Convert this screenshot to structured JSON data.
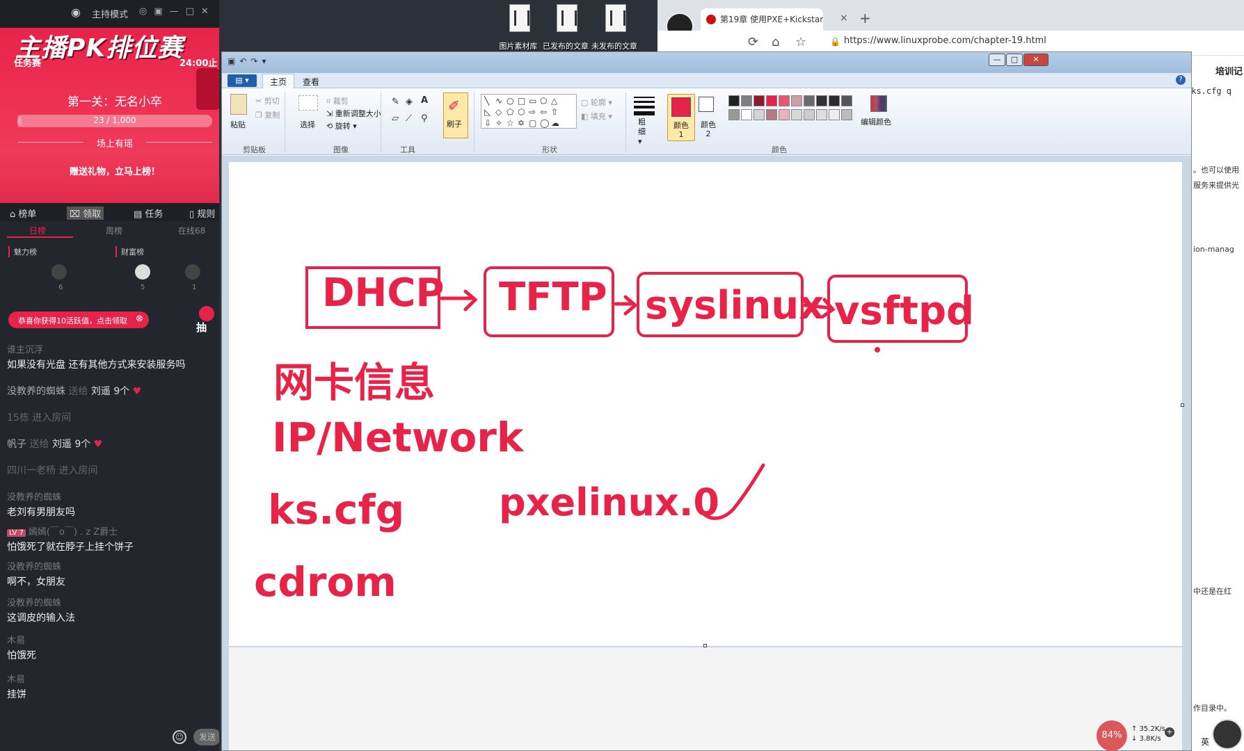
{
  "stream_panel": {
    "mode_label": "主持模式",
    "banner_title": "主播PK排位赛",
    "mission_label": "任务赛",
    "deadline": "24:00止",
    "level": "第一关：无名小卒",
    "progress_text": "23 / 1,000",
    "progress_fraction": 0.023,
    "field_top": "场上有瑶",
    "gift_tip": "赠送礼物，立马上榜！",
    "nav": [
      "榜单",
      "领取",
      "任务",
      "规则"
    ],
    "tabs": [
      "日榜",
      "周榜",
      "在线68"
    ],
    "rank_boards": [
      "魅力榜",
      "财富榜"
    ],
    "rank_nums": [
      "6",
      "5",
      "1"
    ],
    "toast": "恭喜你获得10活跃值，点击领取",
    "lottery_label": "抽",
    "send_label": "发送",
    "chat": [
      {
        "user": "谁主沉浮",
        "text": "如果没有光盘   还有其他方式来安装服务吗"
      },
      {
        "name": "没教养的蜘蛛",
        "action": "送给",
        "gift": "刘遥 9个"
      },
      {
        "name": "15栋",
        "action": "进入房间"
      },
      {
        "name": "帆子",
        "action": "送给",
        "gift": "刘遥 9个"
      },
      {
        "name": "四川一老杨",
        "action": "进入房间"
      },
      {
        "user": "没教养的蜘蛛",
        "text": "老刘有男朋友吗"
      },
      {
        "level": "LV 7",
        "user": "嫣嫣(￣o￣) . z Z爵士",
        "text": "怕饿死了就在脖子上挂个饼子"
      },
      {
        "user": "没教养的蜘蛛",
        "text": "啊不，女朋友"
      },
      {
        "user": "没教养的蜘蛛",
        "text": "这调皮的输入法"
      },
      {
        "user": "木易",
        "text": "怕饿死"
      },
      {
        "user": "木易",
        "text": "挂饼"
      }
    ]
  },
  "desktop_icons": [
    "图片素材库",
    "已发布的文章",
    "未发布的文章"
  ],
  "browser": {
    "tab_title": "第19章 使用PXE+Kickstart无人",
    "tab_close": "×",
    "new_tab": "+",
    "url": "https://www.linuxprobe.com/chapter-19.html",
    "side_title": "培训记",
    "code_line": "/ks.cfg q",
    "snippets": [
      "。也可以使用",
      "服务来提供光",
      "ion-manag",
      "中还是在红",
      "作目录中。"
    ]
  },
  "paint": {
    "ribbon_tabs": [
      "主页",
      "查看"
    ],
    "clipboard": {
      "paste": "粘贴",
      "cut": "剪切",
      "copy": "复制",
      "group": "剪贴板"
    },
    "image": {
      "select": "选择",
      "crop": "裁剪",
      "resize": "重新调整大小",
      "rotate": "旋转",
      "group": "图像"
    },
    "tools_group": "工具",
    "brush_label": "刷子",
    "shapes": {
      "outline": "轮廓",
      "fill": "填充",
      "group": "形状"
    },
    "size_label": "粗细",
    "color1_label": "颜色 1",
    "color2_label": "颜色 2",
    "edit_colors": "编辑颜色",
    "colors_group": "颜色",
    "palette": [
      "#222222",
      "#7f7f7f",
      "#8a1a2c",
      "#e8234a",
      "#e6566f",
      "#c9a0a6",
      "#6b6b6b",
      "#333333",
      "#2b2b2b",
      "#555555",
      "#999999",
      "#ffffff",
      "#d4d4d4",
      "#b47a83",
      "#e8b3bd",
      "#d8d8d8",
      "#cccccc",
      "#dddddd",
      "#eeeeee",
      "#bbbbbb"
    ]
  },
  "drawing": {
    "flow": [
      "DHCP",
      "TFTP",
      "syslinux",
      "vsftpd"
    ],
    "nic_info": "网卡信息",
    "ip_network": "IP/Network",
    "ks_cfg": "ks.cfg",
    "pxelinux": "pxelinux.0",
    "cdrom": "cdrom",
    "ink_color": "#e8234a"
  },
  "tray": {
    "cpu": "84%",
    "up": "35.2K/s",
    "down": "3.8K/s",
    "ime": "英"
  }
}
